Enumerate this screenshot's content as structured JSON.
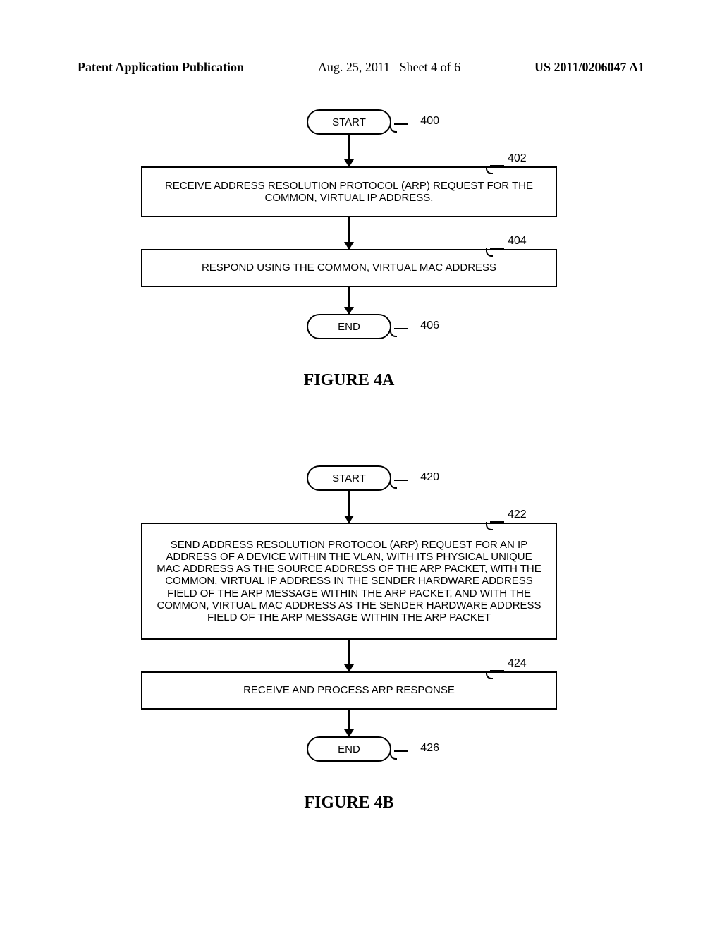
{
  "header": {
    "left": "Patent Application Publication",
    "center_date": "Aug. 25, 2011",
    "center_sheet": "Sheet 4 of 6",
    "right": "US 2011/0206047 A1"
  },
  "chart_data": [
    {
      "type": "flowchart",
      "title": "FIGURE 4A",
      "nodes": [
        {
          "id": "400",
          "shape": "terminal",
          "label": "START"
        },
        {
          "id": "402",
          "shape": "process",
          "label": "RECEIVE ADDRESS RESOLUTION PROTOCOL (ARP) REQUEST FOR THE COMMON, VIRTUAL IP ADDRESS."
        },
        {
          "id": "404",
          "shape": "process",
          "label": "RESPOND USING THE COMMON, VIRTUAL MAC ADDRESS"
        },
        {
          "id": "406",
          "shape": "terminal",
          "label": "END"
        }
      ],
      "edges": [
        {
          "from": "400",
          "to": "402"
        },
        {
          "from": "402",
          "to": "404"
        },
        {
          "from": "404",
          "to": "406"
        }
      ]
    },
    {
      "type": "flowchart",
      "title": "FIGURE 4B",
      "nodes": [
        {
          "id": "420",
          "shape": "terminal",
          "label": "START"
        },
        {
          "id": "422",
          "shape": "process",
          "label": "SEND ADDRESS RESOLUTION PROTOCOL (ARP) REQUEST FOR AN IP ADDRESS OF A DEVICE WITHIN THE VLAN, WITH ITS PHYSICAL UNIQUE MAC ADDRESS AS THE SOURCE ADDRESS OF THE ARP PACKET, WITH THE COMMON, VIRTUAL IP ADDRESS IN THE SENDER HARDWARE ADDRESS FIELD OF THE ARP MESSAGE WITHIN THE ARP PACKET, AND WITH THE COMMON, VIRTUAL MAC ADDRESS AS THE SENDER HARDWARE ADDRESS FIELD OF THE ARP MESSAGE WITHIN THE ARP PACKET"
        },
        {
          "id": "424",
          "shape": "process",
          "label": "RECEIVE AND PROCESS ARP RESPONSE"
        },
        {
          "id": "426",
          "shape": "terminal",
          "label": "END"
        }
      ],
      "edges": [
        {
          "from": "420",
          "to": "422"
        },
        {
          "from": "422",
          "to": "424"
        },
        {
          "from": "424",
          "to": "426"
        }
      ]
    }
  ]
}
